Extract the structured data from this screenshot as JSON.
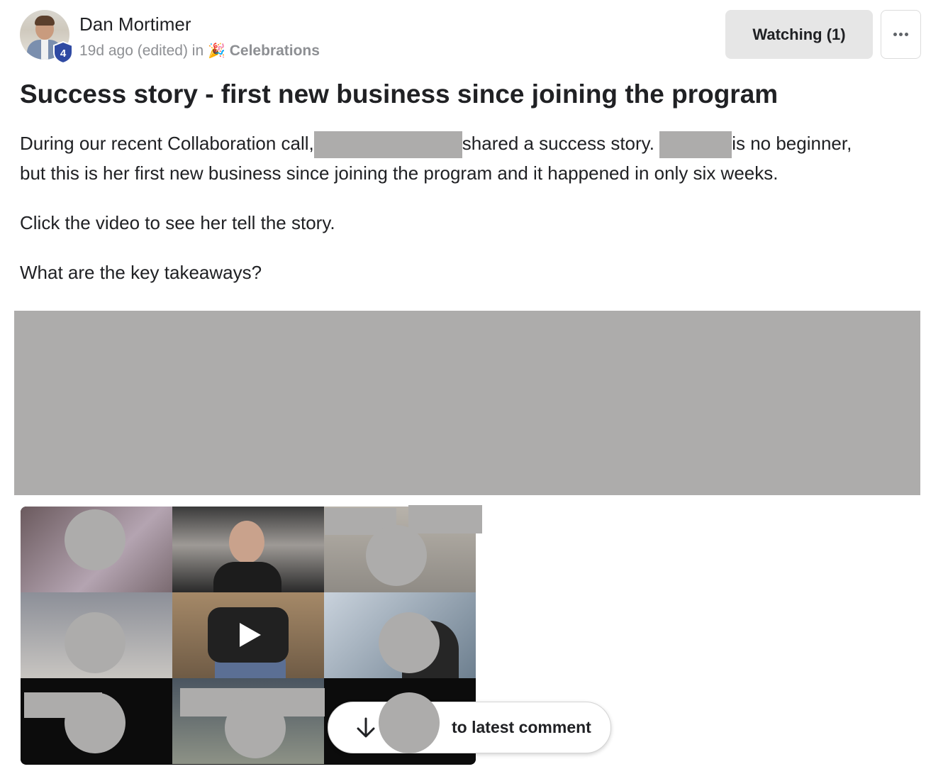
{
  "post": {
    "author": "Dan Mortimer",
    "level": "4",
    "time": "19d ago (edited) in",
    "category_emoji": "🎉",
    "category": "Celebrations",
    "title": "Success story - first new business since joining the program",
    "p1_a": "During our recent Collaboration call,",
    "p1_b": "shared a success story.",
    "p1_c": "is no beginner,",
    "p1_line2": "but this is her first new business since joining the program and it happened in only six weeks.",
    "p2": "Click the video to see her tell the story.",
    "p3": "What are the key takeaways?"
  },
  "actions": {
    "watching": "Watching (1)"
  },
  "jump": {
    "label": "to latest comment"
  },
  "icons": {
    "more": "more-options-icon",
    "play": "play-icon",
    "arrow": "arrow-down-icon",
    "badge": "level-shield-icon"
  },
  "colors": {
    "redaction": "#adacab",
    "badge": "#2f4aa3",
    "button_bg": "#e6e6e6"
  }
}
